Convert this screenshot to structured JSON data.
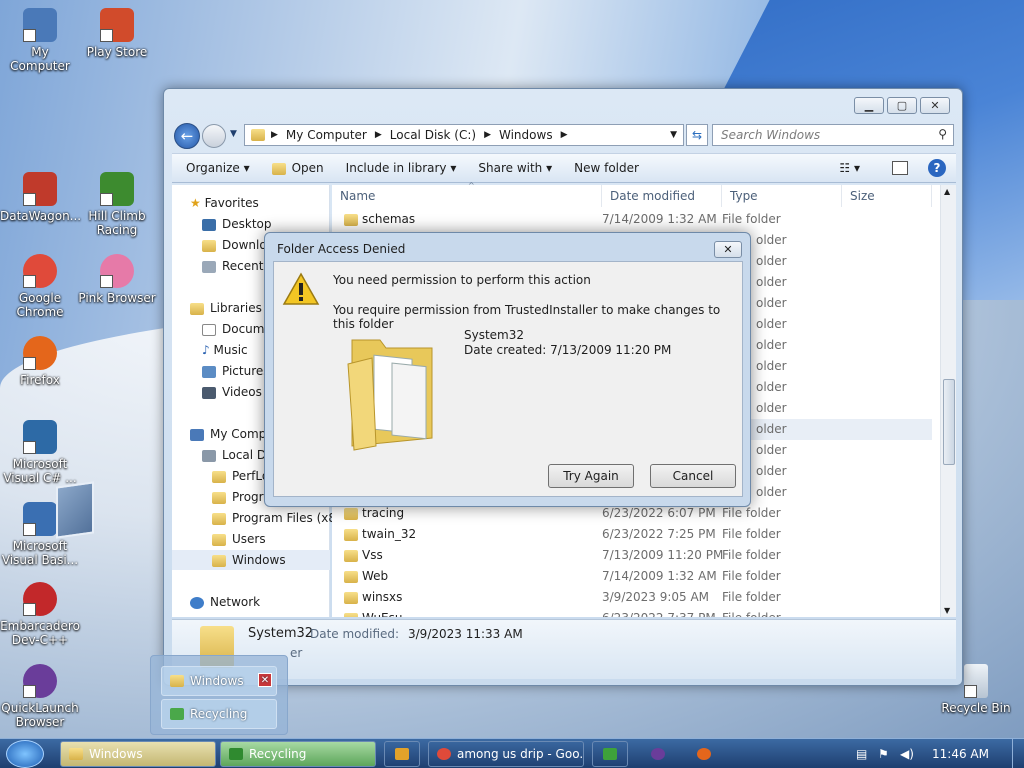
{
  "desktop": {
    "icons": [
      {
        "label": "My Computer",
        "icon": "computer-icon",
        "color": "#4a79b8"
      },
      {
        "label": "Play Store",
        "icon": "play-store-icon",
        "color": "#d14b2b"
      },
      {
        "label": "DataWagon...",
        "icon": "datawagon-icon",
        "color": "#c03a2b"
      },
      {
        "label": "Hill Climb Racing",
        "icon": "hill-climb-icon",
        "color": "#3d8b2f"
      },
      {
        "label": "Google Chrome",
        "icon": "chrome-icon",
        "color": "#e04a3a"
      },
      {
        "label": "Pink Browser",
        "icon": "pink-browser-icon",
        "color": "#e67aa8"
      },
      {
        "label": "Firefox",
        "icon": "firefox-icon",
        "color": "#e4661b"
      },
      {
        "label": "Microsoft Visual C# ...",
        "icon": "visual-csharp-icon",
        "color": "#2d6aa6"
      },
      {
        "label": "Microsoft Visual Basi...",
        "icon": "visual-basic-icon",
        "color": "#3a6fb2"
      },
      {
        "label": "Embarcadero Dev-C++",
        "icon": "devcpp-icon",
        "color": "#c2282a"
      },
      {
        "label": "QuickLaunch Browser",
        "icon": "quicklaunch-icon",
        "color": "#6a3d9a"
      },
      {
        "label": "Recycle Bin",
        "icon": "recycle-bin-icon",
        "color": "#c8d3de"
      }
    ]
  },
  "explorer": {
    "breadcrumb": [
      "My Computer",
      "Local Disk (C:)",
      "Windows"
    ],
    "search_placeholder": "Search Windows",
    "toolbar": {
      "organize": "Organize",
      "open": "Open",
      "include": "Include in library",
      "share": "Share with",
      "new_folder": "New folder"
    },
    "nav": {
      "favorites": "Favorites",
      "desktop": "Desktop",
      "downloads": "Downlo",
      "recent": "Recent P",
      "libraries": "Libraries",
      "documents": "Docume",
      "music": "Music",
      "pictures": "Pictures",
      "videos": "Videos",
      "computer": "My Comp",
      "local_disk": "Local Di",
      "perflogs": "PerfLo",
      "program_files": "Progra",
      "program_files_x86": "Program Files (x86",
      "users": "Users",
      "windows": "Windows",
      "network": "Network"
    },
    "columns": {
      "name": "Name",
      "date": "Date modified",
      "type": "Type",
      "size": "Size"
    },
    "rows_top": [
      {
        "name": "schemas",
        "date": "7/14/2009 1:32 AM",
        "type": "File folder"
      }
    ],
    "rows_hidden_type": "older",
    "rows_bottom": [
      {
        "name": "tracing",
        "date": "6/23/2022 6:07 PM",
        "type": "File folder"
      },
      {
        "name": "twain_32",
        "date": "6/23/2022 7:25 PM",
        "type": "File folder"
      },
      {
        "name": "Vss",
        "date": "7/13/2009 11:20 PM",
        "type": "File folder"
      },
      {
        "name": "Web",
        "date": "7/14/2009 1:32 AM",
        "type": "File folder"
      },
      {
        "name": "winsxs",
        "date": "3/9/2023 9:05 AM",
        "type": "File folder"
      },
      {
        "name": "WuEsu",
        "date": "6/23/2022 7:37 PM",
        "type": "File folder"
      }
    ],
    "details": {
      "name": "System32",
      "date_label": "Date modified:",
      "date": "3/9/2023 11:33 AM",
      "sub": "er"
    }
  },
  "dialog": {
    "title": "Folder Access Denied",
    "close": "✕",
    "heading": "You need permission to perform this action",
    "message": "You require permission from TrustedInstaller to make changes to this folder",
    "folder_name": "System32",
    "date_created": "Date created: 7/13/2009 11:20 PM",
    "try_again": "Try Again",
    "cancel": "Cancel"
  },
  "popup": {
    "items": [
      "Windows",
      "Recycling"
    ]
  },
  "taskbar": {
    "tasks": [
      "Windows",
      "Recycling",
      "among us drip - Goo..."
    ],
    "clock": "11:46 AM"
  },
  "partial_types": "older"
}
